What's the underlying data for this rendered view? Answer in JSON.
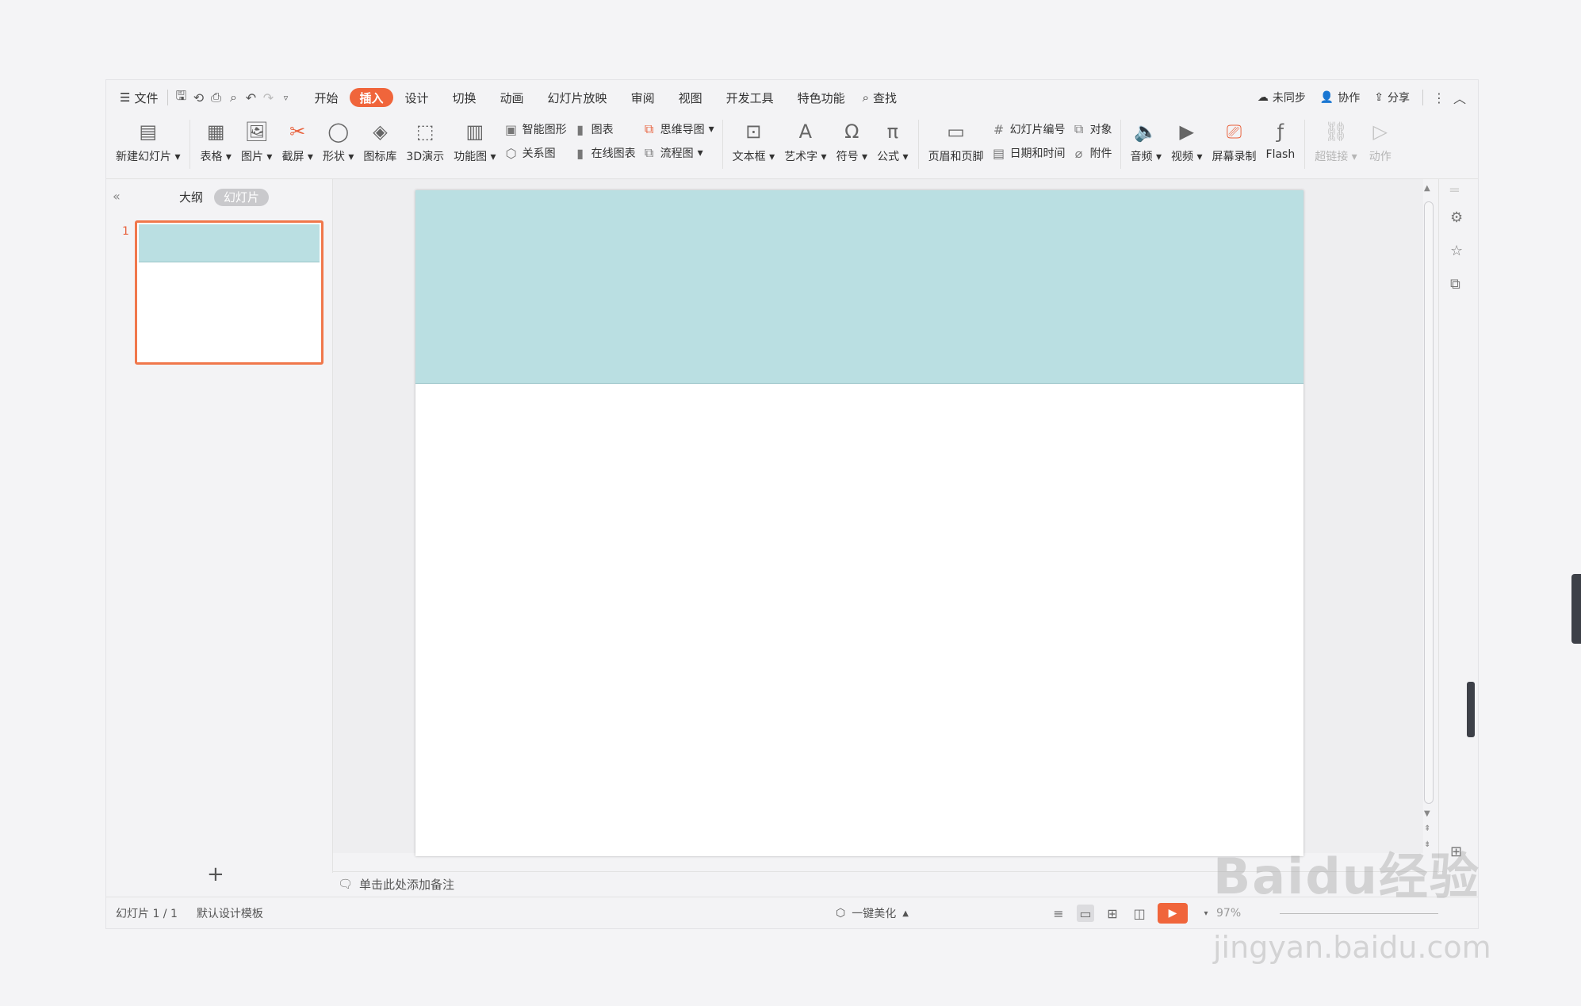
{
  "menubar": {
    "file_label": "文件",
    "tabs": [
      "开始",
      "插入",
      "设计",
      "切换",
      "动画",
      "幻灯片放映",
      "审阅",
      "视图",
      "开发工具",
      "特色功能"
    ],
    "active_tab": "插入",
    "search_label": "查找",
    "sync_label": "未同步",
    "collab_label": "协作",
    "share_label": "分享"
  },
  "ribbon": {
    "new_slide": "新建幻灯片",
    "table": "表格",
    "picture": "图片",
    "screenshot": "截屏",
    "shape": "形状",
    "icon_lib": "图标库",
    "demo3d": "3D演示",
    "func_chart": "功能图",
    "smart_art": "智能图形",
    "chart": "图表",
    "relation": "关系图",
    "online_chart": "在线图表",
    "mind_map": "思维导图",
    "flowchart": "流程图",
    "textbox": "文本框",
    "wordart": "艺术字",
    "symbol": "符号",
    "formula": "公式",
    "header_footer": "页眉和页脚",
    "slide_number": "幻灯片编号",
    "object": "对象",
    "date_time": "日期和时间",
    "attachment": "附件",
    "audio": "音频",
    "video": "视频",
    "screen_record": "屏幕录制",
    "flash": "Flash",
    "hyperlink": "超链接",
    "action": "动作"
  },
  "panel": {
    "outline_tab": "大纲",
    "slides_tab": "幻灯片",
    "slide_number": "1"
  },
  "slide": {
    "band_color": "#badfe2"
  },
  "notes": {
    "placeholder": "单击此处添加备注"
  },
  "status": {
    "slide_count": "幻灯片 1 / 1",
    "template": "默认设计模板",
    "beautify": "一键美化",
    "zoom": "97%"
  },
  "watermark": {
    "brand": "Baidu经验",
    "url": "jingyan.baidu.com"
  }
}
